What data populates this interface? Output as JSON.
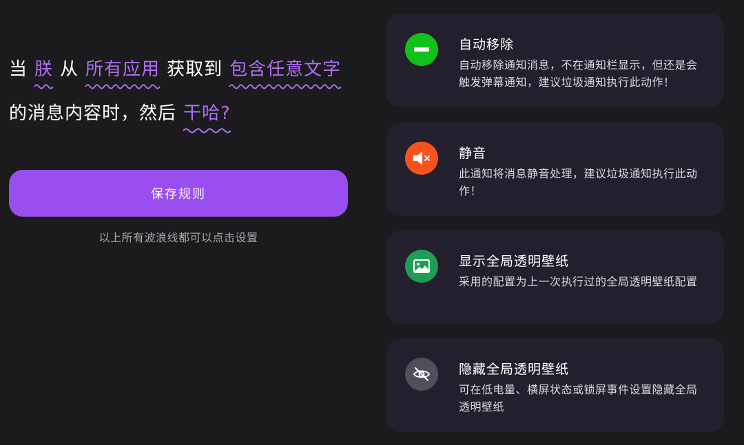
{
  "rule": {
    "when": "当",
    "subject": "朕",
    "from": "从",
    "source": "所有应用",
    "obtain": "获取到",
    "condition": "包含任意文字",
    "content_suffix": "的消息内容时，然后",
    "action": "干哈?"
  },
  "save_button": {
    "label": "保存规则"
  },
  "hint": "以上所有波浪线都可以点击设置",
  "actions": [
    {
      "title": "自动移除",
      "description": "自动移除通知消息，不在通知栏显示，但还是会触发弹幕通知，建议垃圾通知执行此动作！",
      "icon": "minus-icon",
      "color": "#12c117"
    },
    {
      "title": "静音",
      "description": "此通知将消息静音处理，建议垃圾通知执行此动作！",
      "icon": "mute-speaker-icon",
      "color": "#f8531f"
    },
    {
      "title": "显示全局透明壁纸",
      "description": "采用的配置为上一次执行过的全局透明壁纸配置",
      "icon": "image-icon",
      "color": "#1f9d55"
    },
    {
      "title": "隐藏全局透明壁纸",
      "description": "可在低电量、横屏状态或锁屏事件设置隐藏全局透明壁纸",
      "icon": "eye-off-icon",
      "color": "#50505a"
    }
  ],
  "colors": {
    "background": "#1b1b1d",
    "accent": "#9a4ef0",
    "link": "#b06ef3",
    "card": "#241f2c"
  }
}
